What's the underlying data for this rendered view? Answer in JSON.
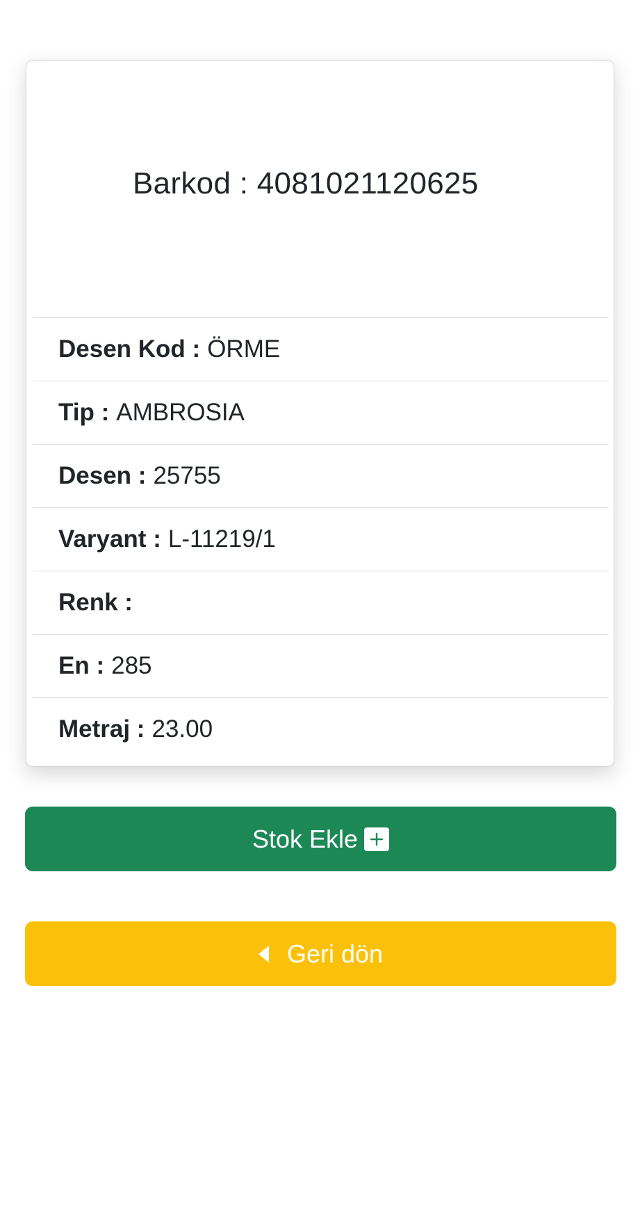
{
  "card": {
    "barcode_text": "Barkod : 4081021120625",
    "details": [
      {
        "label": "Desen Kod :",
        "value": "ÖRME"
      },
      {
        "label": "Tip :",
        "value": "AMBROSIA"
      },
      {
        "label": "Desen :",
        "value": "25755"
      },
      {
        "label": "Varyant :",
        "value": "L-11219/1"
      },
      {
        "label": "Renk :",
        "value": ""
      },
      {
        "label": "En :",
        "value": "285"
      },
      {
        "label": "Metraj :",
        "value": "23.00"
      }
    ]
  },
  "actions": {
    "stock_add_label": "Stok Ekle",
    "stock_add_icon": "plus-square-icon",
    "back_label": "Geri dön",
    "back_icon": "caret-left-icon"
  },
  "colors": {
    "success": "#1c8856",
    "warning": "#fbc10a"
  }
}
